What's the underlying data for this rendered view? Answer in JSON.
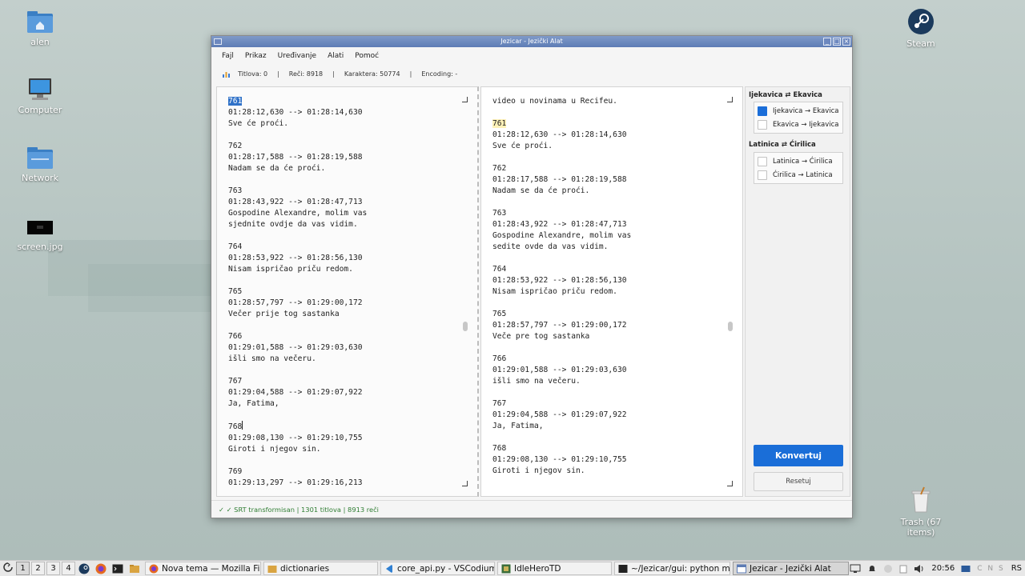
{
  "desktop": {
    "icons": [
      {
        "label": "alen"
      },
      {
        "label": "Computer"
      },
      {
        "label": "Network"
      },
      {
        "label": "screen.jpg"
      },
      {
        "label": "Steam"
      },
      {
        "label": "Trash (67 items)"
      }
    ]
  },
  "window": {
    "title": "Jezicar - Jezički Alat",
    "menu": [
      "Fajl",
      "Prikaz",
      "Uređivanje",
      "Alati",
      "Pomoć"
    ],
    "stats": {
      "titles": "Titlova: 0",
      "words": "Reči: 8918",
      "chars": "Karaktera: 50774",
      "encoding": "Encoding: -"
    },
    "left_text": {
      "selected": "761",
      "before_caret": "01:28:12,630 --> 01:28:14,630\nSve će proći.\n\n762\n01:28:17,588 --> 01:28:19,588\nNadam se da će proći.\n\n763\n01:28:43,922 --> 01:28:47,713\nGospodine Alexandre, molim vas\nsjednite ovdje da vas vidim.\n\n764\n01:28:53,922 --> 01:28:56,130\nNisam ispričao priču redom.\n\n765\n01:28:57,797 --> 01:29:00,172\nVečer prije tog sastanka\n\n766\n01:29:01,588 --> 01:29:03,630\nišli smo na večeru.\n\n767\n01:29:04,588 --> 01:29:07,922\nJa, Fatima,\n\n768",
      "after_caret": "\n01:29:08,130 --> 01:29:10,755\nGiroti i njegov sin.\n\n769\n01:29:13,297 --> 01:29:16,213"
    },
    "right_text": {
      "top": "video u novinama u Recifeu.\n\n",
      "highlighted": "761",
      "rest": "\n01:28:12,630 --> 01:28:14,630\nSve će proći.\n\n762\n01:28:17,588 --> 01:28:19,588\nNadam se da će proći.\n\n763\n01:28:43,922 --> 01:28:47,713\nGospodine Alexandre, molim vas\nsedite ovde da vas vidim.\n\n764\n01:28:53,922 --> 01:28:56,130\nNisam ispričao priču redom.\n\n765\n01:28:57,797 --> 01:29:00,172\nVeče pre tog sastanka\n\n766\n01:29:01,588 --> 01:29:03,630\nišli smo na večeru.\n\n767\n01:29:04,588 --> 01:29:07,922\nJa, Fatima,\n\n768\n01:29:08,130 --> 01:29:10,755\nGiroti i njegov sin."
    },
    "side": {
      "group1_title": "Ijekavica ⇄ Ekavica",
      "group1_opt1": "Ijekavica → Ekavica",
      "group1_opt2": "Ekavica → Ijekavica",
      "group2_title": "Latinica ⇄ Ćirilica",
      "group2_opt1": "Latinica → Ćirilica",
      "group2_opt2": "Ćirilica → Latinica",
      "convert_label": "Konvertuj",
      "reset_label": "Resetuj"
    },
    "status": "✓ ✓ SRT transformisan | 1301 titlova | 8913 reči"
  },
  "taskbar": {
    "workspaces": [
      "1",
      "2",
      "3",
      "4"
    ],
    "tasks": [
      "Nova tema — Mozilla Fir...",
      "dictionaries",
      "core_api.py - VSCodium",
      "IdleHeroTD",
      "~/Jezicar/gui: python ma...",
      "Jezicar - Jezički Alat"
    ],
    "clock": "20:56",
    "indicators": "C N S",
    "layout": "RS"
  },
  "colors": {
    "accent": "#1a6ed8",
    "status_ok": "#2e7d32",
    "selection": "#3072c8",
    "highlight": "#fff2b8"
  }
}
